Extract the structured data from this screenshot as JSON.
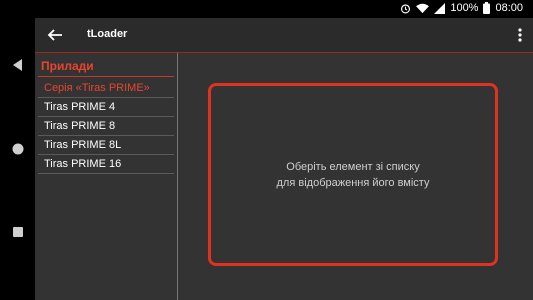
{
  "status": {
    "battery_percent": "100%",
    "time": "08:00",
    "icons": [
      "alarm-icon",
      "wifi-icon",
      "signal-icon",
      "battery-icon"
    ]
  },
  "nav": {
    "icons": [
      "nav-back-icon",
      "nav-home-icon",
      "nav-recents-icon"
    ]
  },
  "toolbar": {
    "title": "tLoader"
  },
  "sidebar": {
    "header": "Прилади",
    "items": [
      {
        "label": "Серія «Tiras PRIME»",
        "type": "group"
      },
      {
        "label": "Tiras PRIME 4",
        "type": "item"
      },
      {
        "label": "Tiras PRIME 8",
        "type": "item"
      },
      {
        "label": "Tiras PRIME 8L",
        "type": "item"
      },
      {
        "label": "Tiras PRIME 16",
        "type": "item"
      }
    ]
  },
  "main": {
    "empty_line1": "Оберіть елемент зі списку",
    "empty_line2": "для відображення його вмісту"
  },
  "colors": {
    "accent": "#e8442e",
    "background": "#333333",
    "toolbar": "#2b2b2b"
  }
}
